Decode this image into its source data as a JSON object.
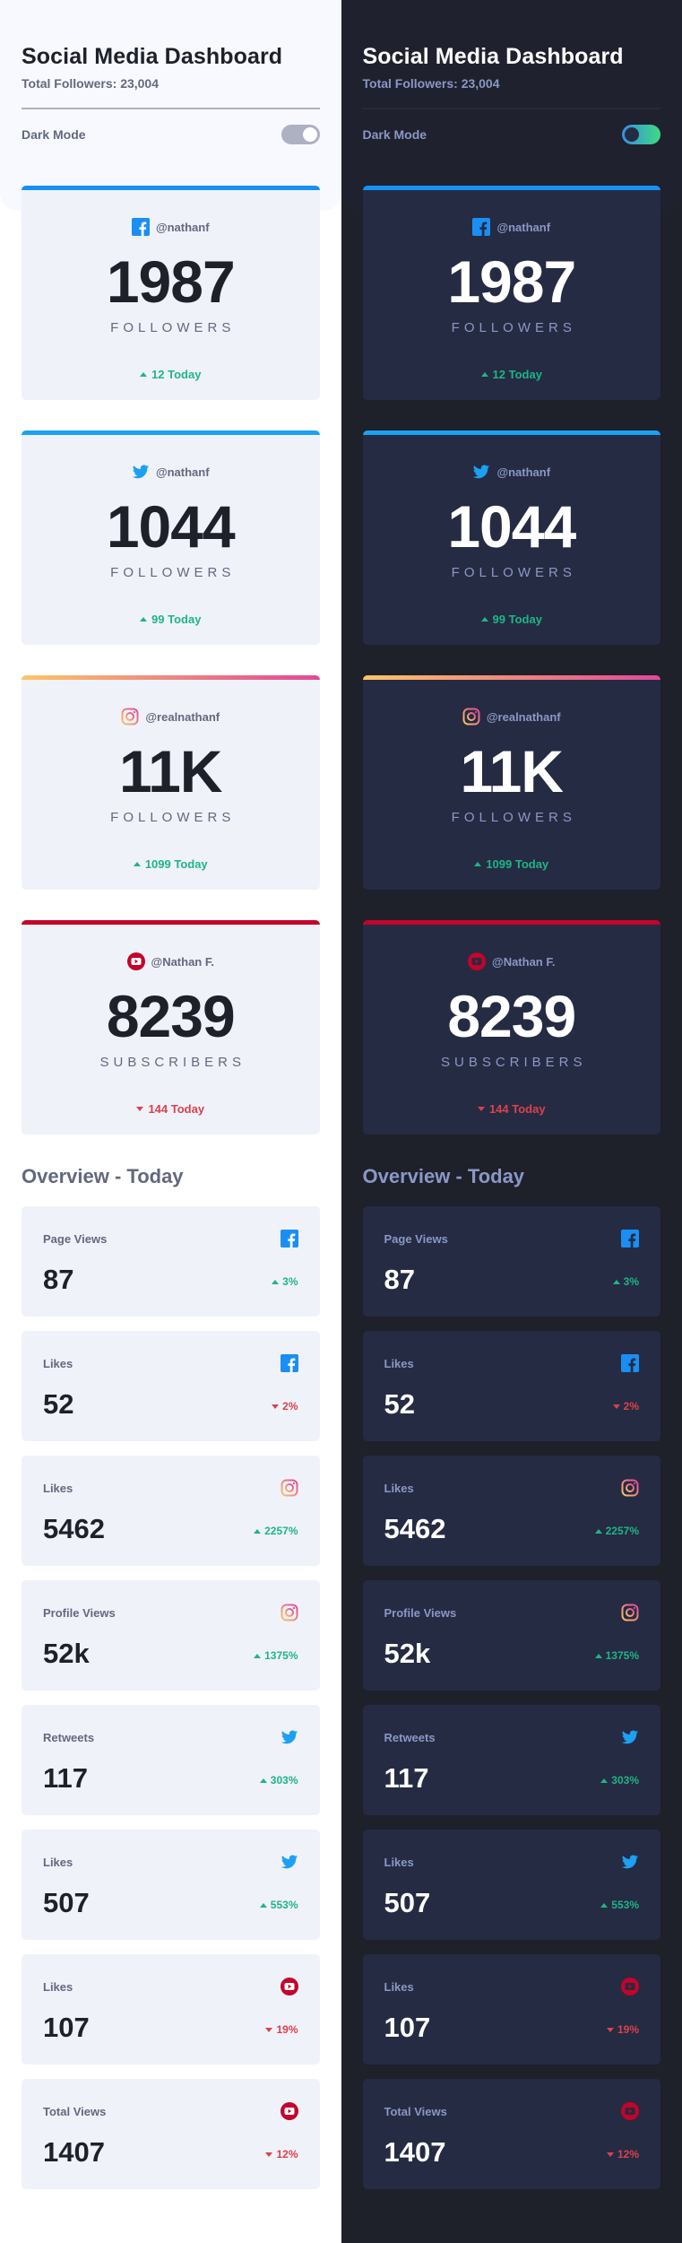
{
  "header": {
    "title": "Social Media Dashboard",
    "total_followers": "Total Followers: 23,004",
    "dark_mode_label": "Dark Mode"
  },
  "colors": {
    "facebook": "#198ff5",
    "twitter": "#1ca0f2",
    "instagram_start": "#fdc468",
    "instagram_end": "#df4996",
    "youtube": "#c4032b",
    "up": "#1eb589",
    "down": "#dc414c"
  },
  "cards": [
    {
      "platform": "facebook",
      "icon": "facebook-icon",
      "handle": "@nathanf",
      "count": "1987",
      "unit": "FOLLOWERS",
      "delta": "12 Today",
      "trend": "up"
    },
    {
      "platform": "twitter",
      "icon": "twitter-icon",
      "handle": "@nathanf",
      "count": "1044",
      "unit": "FOLLOWERS",
      "delta": "99 Today",
      "trend": "up"
    },
    {
      "platform": "instagram",
      "icon": "instagram-icon",
      "handle": "@realnathanf",
      "count": "11K",
      "unit": "FOLLOWERS",
      "delta": "1099 Today",
      "trend": "up"
    },
    {
      "platform": "youtube",
      "icon": "youtube-icon",
      "handle": "@Nathan F.",
      "count": "8239",
      "unit": "SUBSCRIBERS",
      "delta": "144 Today",
      "trend": "down"
    }
  ],
  "overview": {
    "title": "Overview - Today",
    "items": [
      {
        "label": "Page Views",
        "icon": "facebook-icon",
        "value": "87",
        "delta": "3%",
        "trend": "up"
      },
      {
        "label": "Likes",
        "icon": "facebook-icon",
        "value": "52",
        "delta": "2%",
        "trend": "down"
      },
      {
        "label": "Likes",
        "icon": "instagram-icon",
        "value": "5462",
        "delta": "2257%",
        "trend": "up"
      },
      {
        "label": "Profile Views",
        "icon": "instagram-icon",
        "value": "52k",
        "delta": "1375%",
        "trend": "up"
      },
      {
        "label": "Retweets",
        "icon": "twitter-icon",
        "value": "117",
        "delta": "303%",
        "trend": "up"
      },
      {
        "label": "Likes",
        "icon": "twitter-icon",
        "value": "507",
        "delta": "553%",
        "trend": "up"
      },
      {
        "label": "Likes",
        "icon": "youtube-icon",
        "value": "107",
        "delta": "19%",
        "trend": "down"
      },
      {
        "label": "Total Views",
        "icon": "youtube-icon",
        "value": "1407",
        "delta": "12%",
        "trend": "down"
      }
    ]
  }
}
